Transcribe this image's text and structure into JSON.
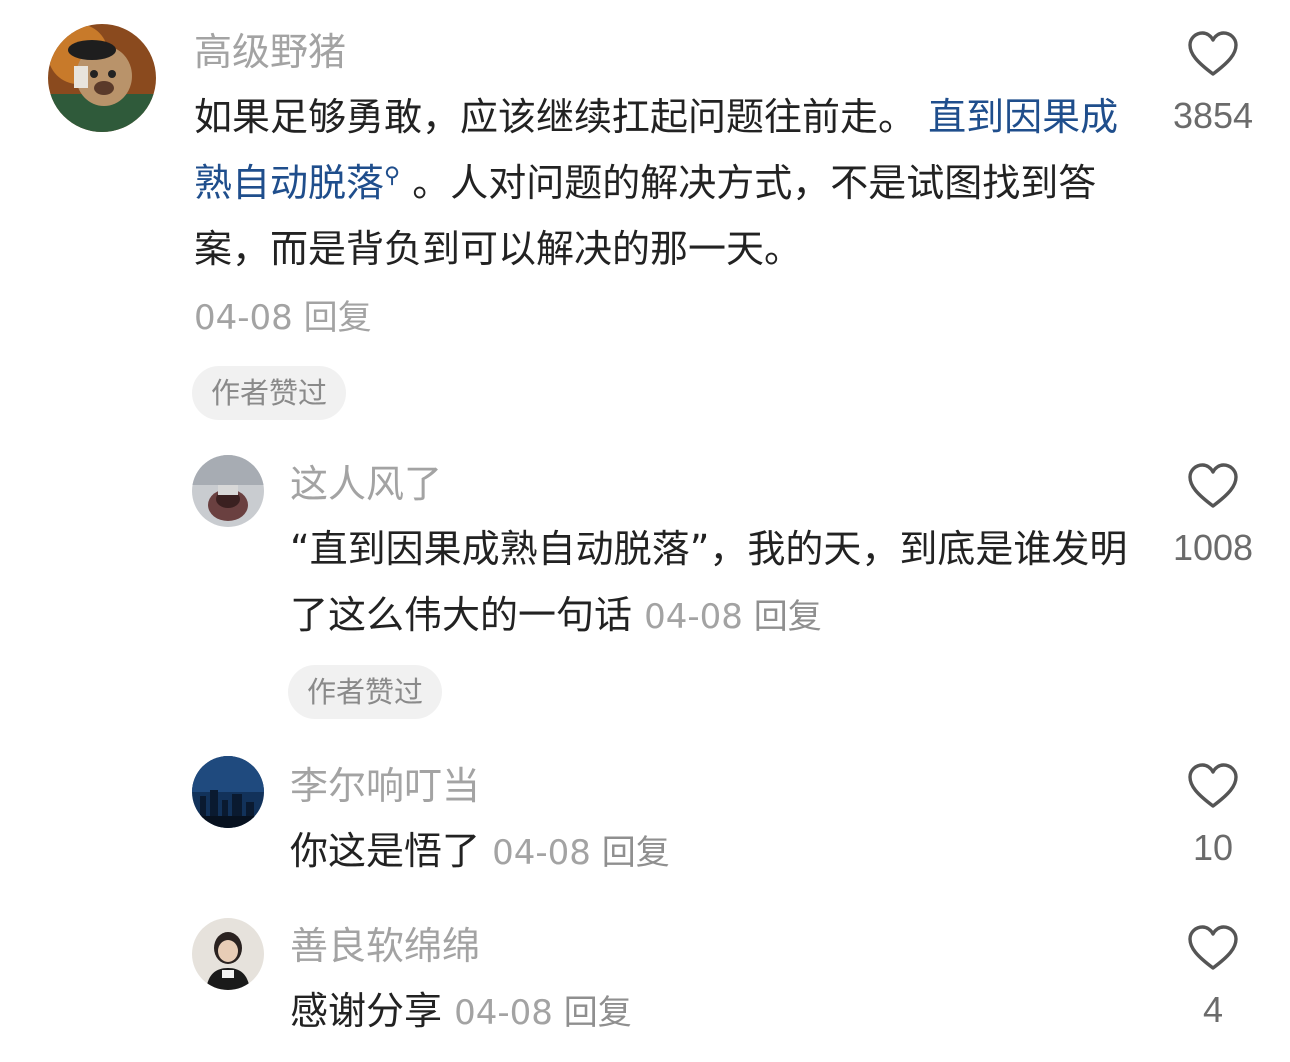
{
  "comments": [
    {
      "username": "高级野猪",
      "text_part1": "如果足够勇敢，应该继续扛起问题往前走。",
      "text_link": "直到因果成熟自动脱落",
      "text_part2": "。人对问题的解决方式，不是试图找到答案，而是背负到可以解决的那一天。",
      "date": "04-08",
      "reply_label": "回复",
      "badge": "作者赞过",
      "likes": "3854"
    },
    {
      "username": "这人风了",
      "text": "“直到因果成熟自动脱落”，我的天，到底是谁发明了这么伟大的一句话",
      "date": "04-08",
      "reply_label": "回复",
      "badge": "作者赞过",
      "likes": "1008"
    },
    {
      "username": "李尔响叮当",
      "text": "你这是悟了",
      "date": "04-08",
      "reply_label": "回复",
      "likes": "10"
    },
    {
      "username": "善良软绵绵",
      "text": "感谢分享",
      "date": "04-08",
      "reply_label": "回复",
      "likes": "4"
    }
  ],
  "icons": {
    "like": "heart-outline-icon",
    "link_search": "search-icon"
  },
  "colors": {
    "username": "#a3a3a3",
    "link": "#1f4e8c",
    "badge_bg": "#f1f1f1"
  }
}
